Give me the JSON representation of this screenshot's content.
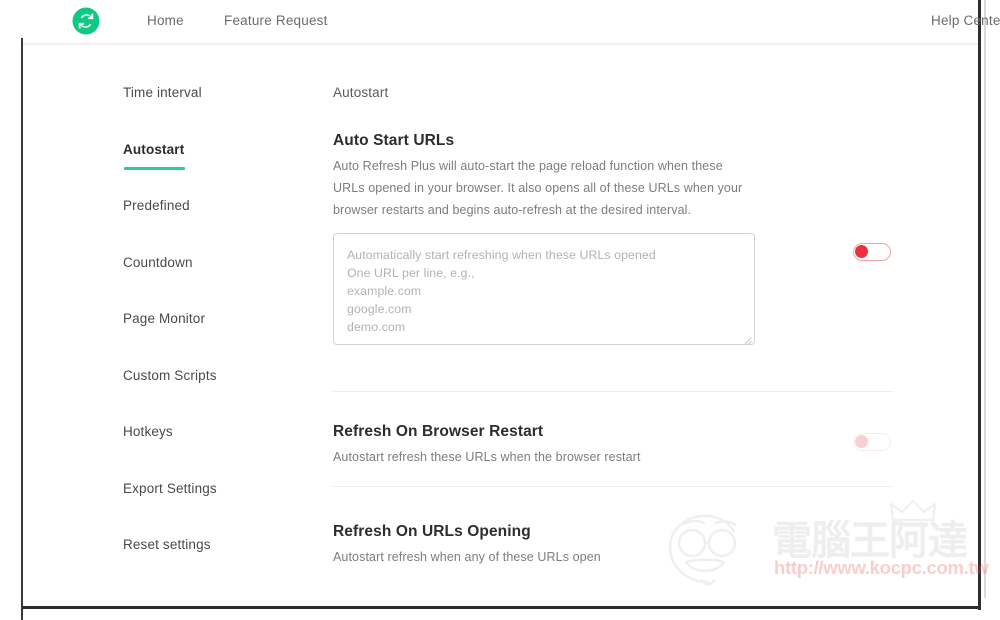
{
  "header": {
    "logo_icon": "auto-refresh-logo-icon",
    "logo_color": "#0ec983",
    "nav": [
      {
        "label": "Home"
      },
      {
        "label": "Feature Request"
      }
    ],
    "help_label": "Help Center"
  },
  "sidebar": {
    "items": [
      {
        "label": "Time interval",
        "active": false
      },
      {
        "label": "Autostart",
        "active": true
      },
      {
        "label": "Predefined",
        "active": false
      },
      {
        "label": "Countdown",
        "active": false
      },
      {
        "label": "Page Monitor",
        "active": false
      },
      {
        "label": "Custom Scripts",
        "active": false
      },
      {
        "label": "Hotkeys",
        "active": false
      },
      {
        "label": "Export Settings",
        "active": false
      },
      {
        "label": "Reset settings",
        "active": false
      }
    ],
    "active_accent_color": "#2ecc8f"
  },
  "main": {
    "panel_title": "Autostart",
    "sections": [
      {
        "heading": "Auto Start URLs",
        "description": "Auto Refresh Plus will auto-start the page reload function when these URLs opened in your browser. It also opens all of these URLs when your browser restarts and begins auto-refresh at the desired interval.",
        "textarea": {
          "value": "",
          "placeholder_lines": [
            "Automatically start refreshing when these URLs opened",
            "One URL per line, e.g.,",
            "example.com",
            "google.com",
            "demo.com"
          ]
        },
        "toggle": {
          "state": "off",
          "enabled": true
        }
      },
      {
        "heading": "Refresh On Browser Restart",
        "description": "Autostart refresh these URLs when the browser restart",
        "toggle": {
          "state": "off",
          "enabled": false
        }
      },
      {
        "heading": "Refresh On URLs Opening",
        "description": "Autostart refresh when any of these URLs open",
        "toggle": null
      }
    ],
    "toggle_colors": {
      "knob_on_off": "#ee2f3f",
      "track_border": "#f3a6a6"
    }
  },
  "watermark": {
    "brand_text": "電腦王阿達",
    "url_text": "http://www.kocpc.com.tw",
    "url_color": "#f05a5a"
  }
}
